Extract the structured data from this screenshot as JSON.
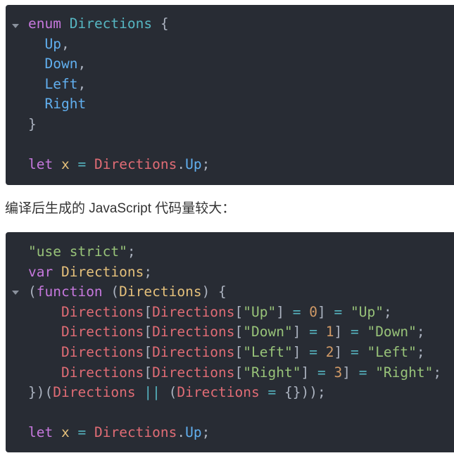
{
  "block1": {
    "lines": [
      [
        {
          "t": "enum",
          "c": "kw"
        },
        {
          "t": " ",
          "c": "pun"
        },
        {
          "t": "Directions",
          "c": "type"
        },
        {
          "t": " {",
          "c": "pun"
        }
      ],
      [
        {
          "t": "  ",
          "c": "pun"
        },
        {
          "t": "Up",
          "c": "mem"
        },
        {
          "t": ",",
          "c": "pun"
        }
      ],
      [
        {
          "t": "  ",
          "c": "pun"
        },
        {
          "t": "Down",
          "c": "mem"
        },
        {
          "t": ",",
          "c": "pun"
        }
      ],
      [
        {
          "t": "  ",
          "c": "pun"
        },
        {
          "t": "Left",
          "c": "mem"
        },
        {
          "t": ",",
          "c": "pun"
        }
      ],
      [
        {
          "t": "  ",
          "c": "pun"
        },
        {
          "t": "Right",
          "c": "mem"
        }
      ],
      [
        {
          "t": "}",
          "c": "pun"
        }
      ],
      [],
      [
        {
          "t": "let",
          "c": "kw"
        },
        {
          "t": " ",
          "c": "pun"
        },
        {
          "t": "x",
          "c": "def"
        },
        {
          "t": " ",
          "c": "pun"
        },
        {
          "t": "=",
          "c": "op"
        },
        {
          "t": " ",
          "c": "pun"
        },
        {
          "t": "Directions",
          "c": "var"
        },
        {
          "t": ".",
          "c": "pun"
        },
        {
          "t": "Up",
          "c": "mem"
        },
        {
          "t": ";",
          "c": "pun"
        }
      ]
    ]
  },
  "caption": "编译后生成的 JavaScript 代码量较大：",
  "block2": {
    "lines": [
      [
        {
          "t": "\"use strict\"",
          "c": "str"
        },
        {
          "t": ";",
          "c": "pun"
        }
      ],
      [
        {
          "t": "var",
          "c": "kw"
        },
        {
          "t": " ",
          "c": "pun"
        },
        {
          "t": "Directions",
          "c": "def"
        },
        {
          "t": ";",
          "c": "pun"
        }
      ],
      [
        {
          "t": "(",
          "c": "pun"
        },
        {
          "t": "function",
          "c": "kw"
        },
        {
          "t": " (",
          "c": "pun"
        },
        {
          "t": "Directions",
          "c": "def"
        },
        {
          "t": ") {",
          "c": "pun"
        }
      ],
      [
        {
          "t": "    ",
          "c": "pun"
        },
        {
          "t": "Directions",
          "c": "var"
        },
        {
          "t": "[",
          "c": "pun"
        },
        {
          "t": "Directions",
          "c": "var"
        },
        {
          "t": "[",
          "c": "pun"
        },
        {
          "t": "\"Up\"",
          "c": "str"
        },
        {
          "t": "] ",
          "c": "pun"
        },
        {
          "t": "=",
          "c": "op"
        },
        {
          "t": " ",
          "c": "pun"
        },
        {
          "t": "0",
          "c": "num"
        },
        {
          "t": "] ",
          "c": "pun"
        },
        {
          "t": "=",
          "c": "op"
        },
        {
          "t": " ",
          "c": "pun"
        },
        {
          "t": "\"Up\"",
          "c": "str"
        },
        {
          "t": ";",
          "c": "pun"
        }
      ],
      [
        {
          "t": "    ",
          "c": "pun"
        },
        {
          "t": "Directions",
          "c": "var"
        },
        {
          "t": "[",
          "c": "pun"
        },
        {
          "t": "Directions",
          "c": "var"
        },
        {
          "t": "[",
          "c": "pun"
        },
        {
          "t": "\"Down\"",
          "c": "str"
        },
        {
          "t": "] ",
          "c": "pun"
        },
        {
          "t": "=",
          "c": "op"
        },
        {
          "t": " ",
          "c": "pun"
        },
        {
          "t": "1",
          "c": "num"
        },
        {
          "t": "] ",
          "c": "pun"
        },
        {
          "t": "=",
          "c": "op"
        },
        {
          "t": " ",
          "c": "pun"
        },
        {
          "t": "\"Down\"",
          "c": "str"
        },
        {
          "t": ";",
          "c": "pun"
        }
      ],
      [
        {
          "t": "    ",
          "c": "pun"
        },
        {
          "t": "Directions",
          "c": "var"
        },
        {
          "t": "[",
          "c": "pun"
        },
        {
          "t": "Directions",
          "c": "var"
        },
        {
          "t": "[",
          "c": "pun"
        },
        {
          "t": "\"Left\"",
          "c": "str"
        },
        {
          "t": "] ",
          "c": "pun"
        },
        {
          "t": "=",
          "c": "op"
        },
        {
          "t": " ",
          "c": "pun"
        },
        {
          "t": "2",
          "c": "num"
        },
        {
          "t": "] ",
          "c": "pun"
        },
        {
          "t": "=",
          "c": "op"
        },
        {
          "t": " ",
          "c": "pun"
        },
        {
          "t": "\"Left\"",
          "c": "str"
        },
        {
          "t": ";",
          "c": "pun"
        }
      ],
      [
        {
          "t": "    ",
          "c": "pun"
        },
        {
          "t": "Directions",
          "c": "var"
        },
        {
          "t": "[",
          "c": "pun"
        },
        {
          "t": "Directions",
          "c": "var"
        },
        {
          "t": "[",
          "c": "pun"
        },
        {
          "t": "\"Right\"",
          "c": "str"
        },
        {
          "t": "] ",
          "c": "pun"
        },
        {
          "t": "=",
          "c": "op"
        },
        {
          "t": " ",
          "c": "pun"
        },
        {
          "t": "3",
          "c": "num"
        },
        {
          "t": "] ",
          "c": "pun"
        },
        {
          "t": "=",
          "c": "op"
        },
        {
          "t": " ",
          "c": "pun"
        },
        {
          "t": "\"Right\"",
          "c": "str"
        },
        {
          "t": ";",
          "c": "pun"
        }
      ],
      [
        {
          "t": "})(",
          "c": "pun"
        },
        {
          "t": "Directions",
          "c": "var"
        },
        {
          "t": " ",
          "c": "pun"
        },
        {
          "t": "||",
          "c": "op"
        },
        {
          "t": " (",
          "c": "pun"
        },
        {
          "t": "Directions",
          "c": "var"
        },
        {
          "t": " ",
          "c": "pun"
        },
        {
          "t": "=",
          "c": "op"
        },
        {
          "t": " {}));",
          "c": "pun"
        }
      ],
      [],
      [
        {
          "t": "let",
          "c": "kw"
        },
        {
          "t": " ",
          "c": "pun"
        },
        {
          "t": "x",
          "c": "def"
        },
        {
          "t": " ",
          "c": "pun"
        },
        {
          "t": "=",
          "c": "op"
        },
        {
          "t": " ",
          "c": "pun"
        },
        {
          "t": "Directions",
          "c": "var"
        },
        {
          "t": ".",
          "c": "pun"
        },
        {
          "t": "Up",
          "c": "mem"
        },
        {
          "t": ";",
          "c": "pun"
        }
      ]
    ]
  },
  "colors": {
    "background": "#ffffff",
    "code_bg": "#282c34",
    "keyword": "#c678dd",
    "type": "#56b6c2",
    "member": "#61afef",
    "variable": "#e06c75",
    "string": "#98c379",
    "number": "#d19a66",
    "definition": "#e5c07b",
    "punctuation": "#abb2bf"
  }
}
